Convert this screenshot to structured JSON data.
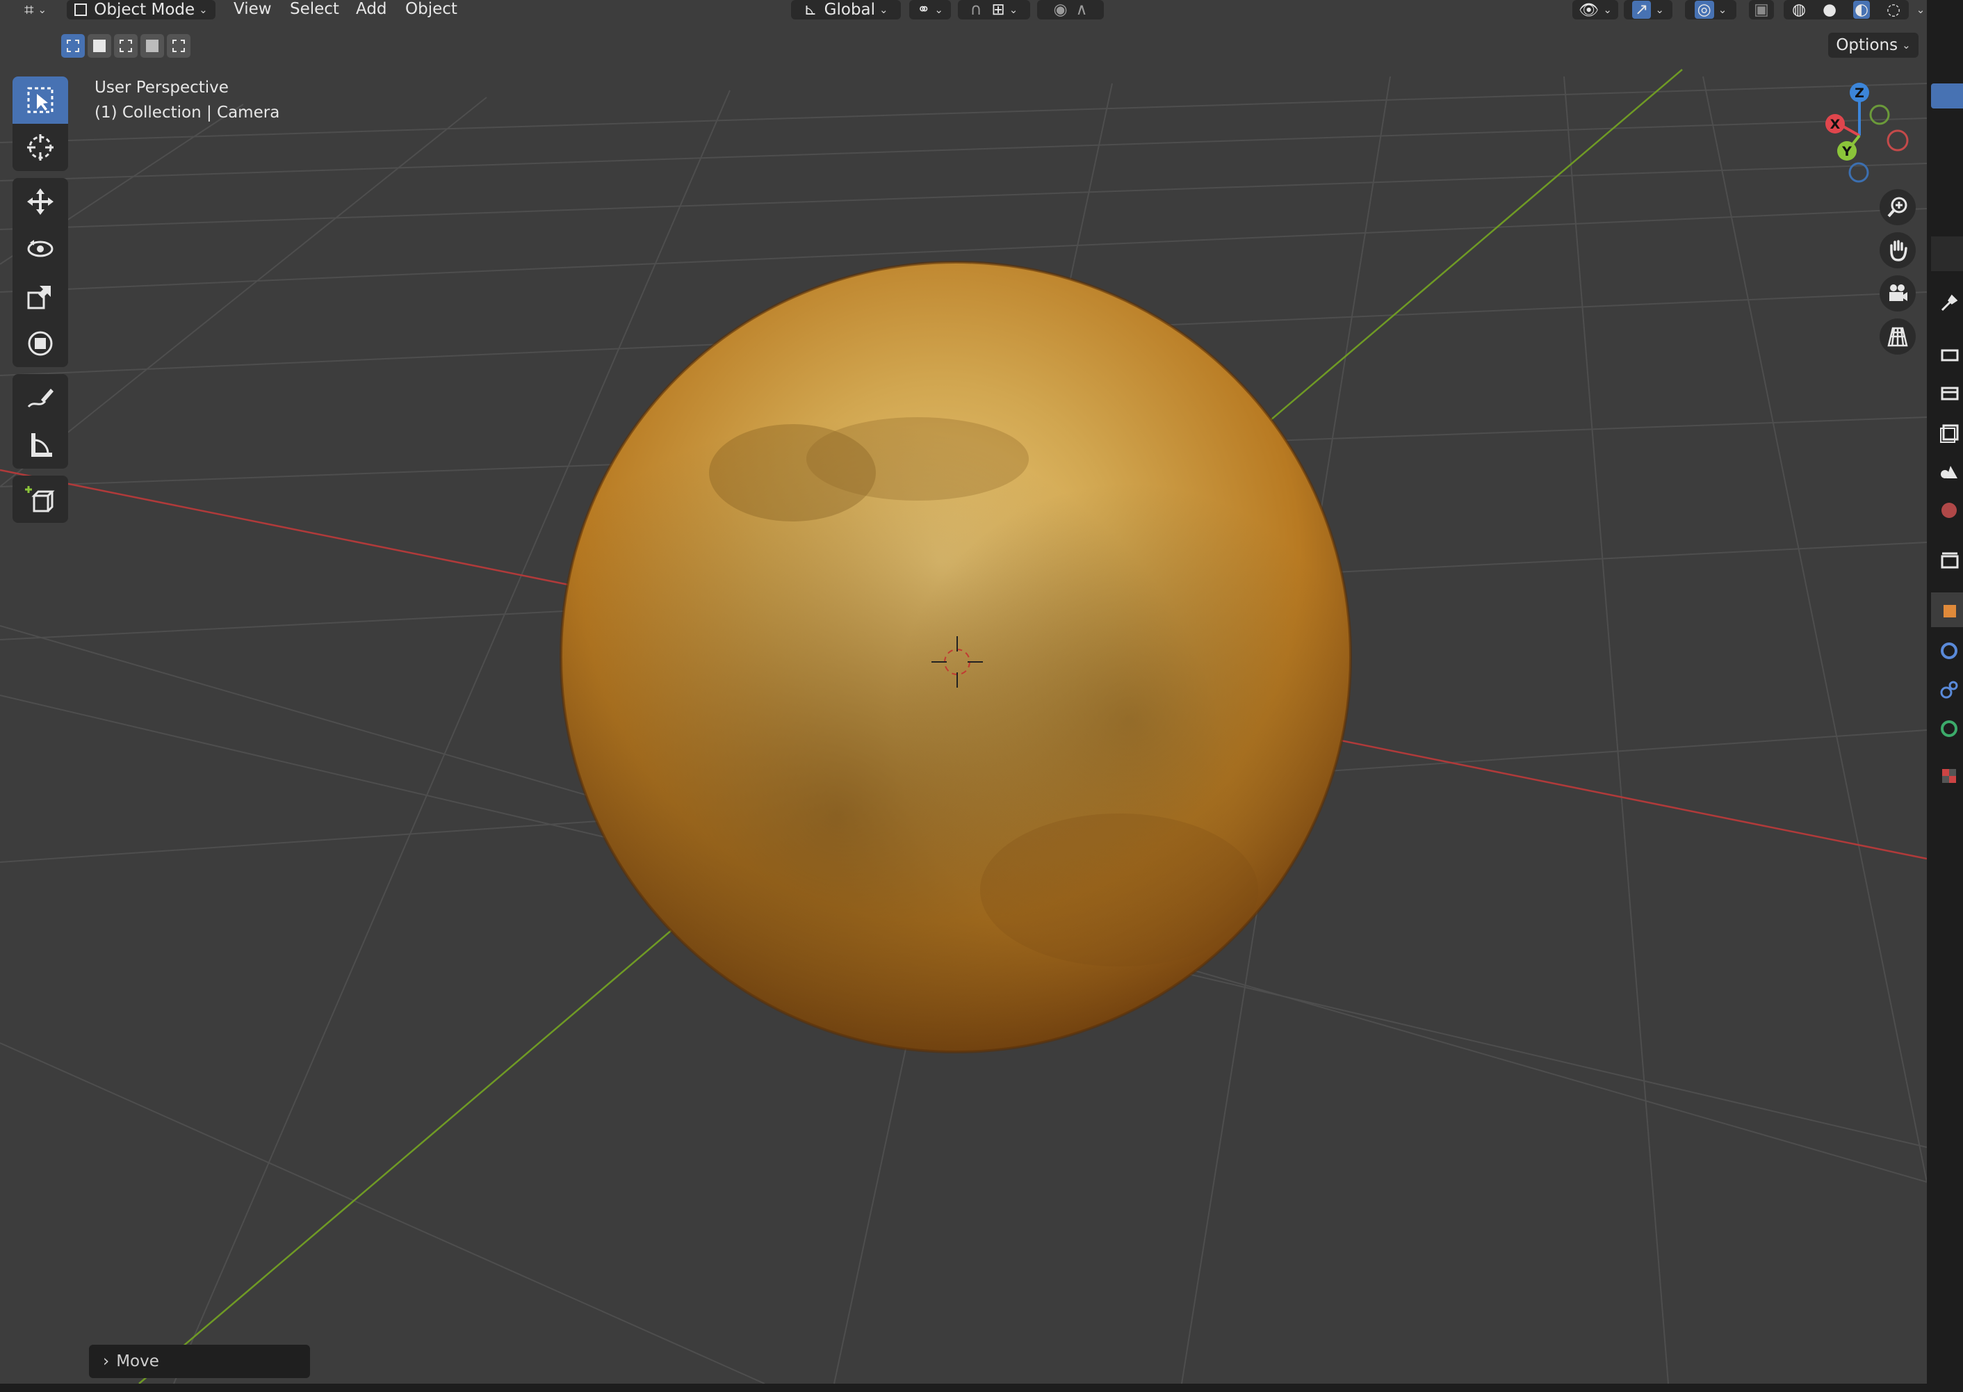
{
  "header": {
    "editor_type_icon": "3d-viewport-icon",
    "mode_label": "Object Mode",
    "menus": [
      "View",
      "Select",
      "Add",
      "Object"
    ],
    "orientation_label": "Global"
  },
  "tool_settings": {
    "select_mode_icons": [
      "select-new-icon",
      "select-extend-icon",
      "select-subtract-icon",
      "select-invert-icon",
      "select-intersect-icon"
    ],
    "options_label": "Options"
  },
  "toolbar": {
    "tools": [
      "select-box-icon",
      "cursor-icon",
      "move-icon",
      "rotate-icon",
      "scale-icon",
      "transform-icon",
      "annotate-icon",
      "measure-icon",
      "add-cube-icon"
    ]
  },
  "viewport": {
    "view_name": "User Perspective",
    "collection_info": "(1) Collection | Camera",
    "object": "gold-metal-sphere",
    "colors": {
      "background": "#3d3d3d",
      "x_axis": "#c5423f",
      "y_axis": "#84ad2c",
      "gold": "#c98a2a"
    }
  },
  "gizmo": {
    "axes": [
      "X",
      "Y",
      "Z"
    ],
    "colors": {
      "x": "#e0464d",
      "y": "#8bc53a",
      "z": "#3c85d9"
    }
  },
  "nav_buttons": [
    "zoom-icon",
    "pan-hand-icon",
    "camera-view-icon",
    "perspective-grid-icon"
  ],
  "last_operator": {
    "label": "Move"
  },
  "properties_tabs": [
    "tool-icon",
    "render-icon",
    "output-icon",
    "view-layer-icon",
    "scene-icon",
    "world-icon",
    "collection-icon",
    "object-icon",
    "modifier-icon",
    "particles-icon",
    "physics-icon",
    "texture-icon"
  ]
}
